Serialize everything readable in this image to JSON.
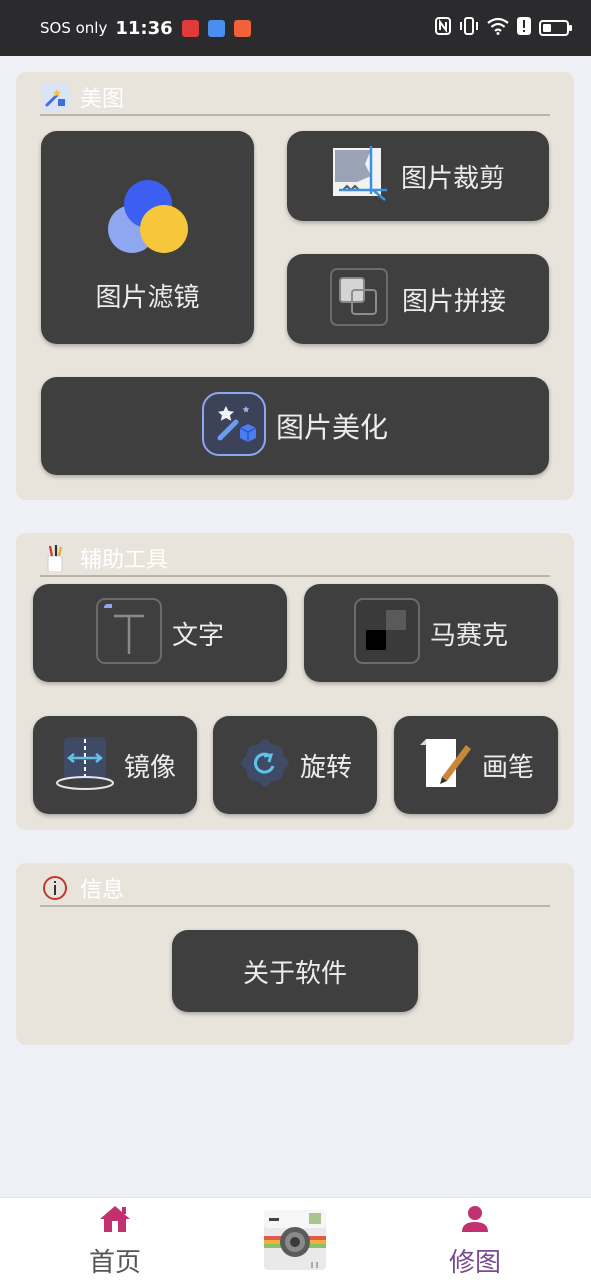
{
  "status_bar": {
    "carrier": "SOS only",
    "time": "11:36",
    "app_icon_colors": [
      "#e03b3b",
      "#4a8ef0",
      "#f2613a"
    ],
    "right_icons": [
      "nfc-icon",
      "vibrate-icon",
      "wifi-icon",
      "alert-icon",
      "battery-icon"
    ]
  },
  "sections": {
    "beautify": {
      "title": "美图",
      "icon": "magic-wand-icon",
      "buttons": {
        "filter": "图片滤镜",
        "crop": "图片裁剪",
        "stitch": "图片拼接",
        "beautify": "图片美化"
      }
    },
    "tools": {
      "title": "辅助工具",
      "icon": "brush-cup-icon",
      "buttons": {
        "text": "文字",
        "mosaic": "马赛克",
        "mirror": "镜像",
        "rotate": "旋转",
        "brush": "画笔"
      }
    },
    "info": {
      "title": "信息",
      "icon": "info-icon",
      "buttons": {
        "about": "关于软件"
      }
    }
  },
  "bottom_nav": {
    "items": [
      {
        "label": "首页",
        "icon": "home-icon",
        "active": true
      },
      {
        "label": "",
        "icon": "camera-icon",
        "active": false
      },
      {
        "label": "修图",
        "icon": "user-icon",
        "active": false
      }
    ]
  },
  "colors": {
    "panel_bg": "#e8e4dc",
    "tile_bg": "#3f3f3f",
    "accent": "#c2306f",
    "page_bg": "#eff0f5"
  }
}
